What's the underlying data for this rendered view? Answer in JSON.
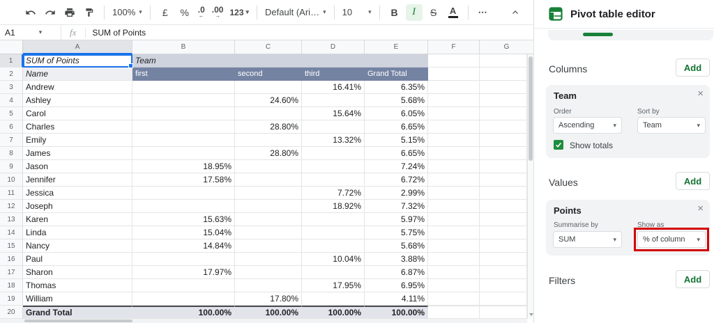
{
  "toolbar": {
    "zoom_value": "100%",
    "currency_label": "£",
    "percent_label": "%",
    "decrease_decimal_label": ".0",
    "decrease_decimal_arrow": "←",
    "increase_decimal_label": ".00",
    "increase_decimal_arrow": "→",
    "more_formats_label": "123",
    "font_value": "Default (Ari…",
    "font_size_value": "10",
    "bold_label": "B",
    "italic_label": "I",
    "strikethrough_label": "S",
    "text_color_label": "A",
    "more_label": "⋯"
  },
  "formula_bar": {
    "cell_ref": "A1",
    "value": "SUM of Points"
  },
  "sheet": {
    "column_letters": [
      "A",
      "B",
      "C",
      "D",
      "E",
      "F",
      "G"
    ],
    "pivot": {
      "title_row": {
        "num": "1",
        "a": "SUM of Points",
        "b": "Team"
      },
      "header_row": {
        "num": "2",
        "a": "Name",
        "first": "first",
        "second": "second",
        "third": "third",
        "grand_total": "Grand Total"
      },
      "rows": [
        {
          "num": "3",
          "name": "Andrew",
          "first": "",
          "second": "",
          "third": "16.41%",
          "grand_total": "6.35%"
        },
        {
          "num": "4",
          "name": "Ashley",
          "first": "",
          "second": "24.60%",
          "third": "",
          "grand_total": "5.68%"
        },
        {
          "num": "5",
          "name": "Carol",
          "first": "",
          "second": "",
          "third": "15.64%",
          "grand_total": "6.05%"
        },
        {
          "num": "6",
          "name": "Charles",
          "first": "",
          "second": "28.80%",
          "third": "",
          "grand_total": "6.65%"
        },
        {
          "num": "7",
          "name": "Emily",
          "first": "",
          "second": "",
          "third": "13.32%",
          "grand_total": "5.15%"
        },
        {
          "num": "8",
          "name": "James",
          "first": "",
          "second": "28.80%",
          "third": "",
          "grand_total": "6.65%"
        },
        {
          "num": "9",
          "name": "Jason",
          "first": "18.95%",
          "second": "",
          "third": "",
          "grand_total": "7.24%"
        },
        {
          "num": "10",
          "name": "Jennifer",
          "first": "17.58%",
          "second": "",
          "third": "",
          "grand_total": "6.72%"
        },
        {
          "num": "11",
          "name": "Jessica",
          "first": "",
          "second": "",
          "third": "7.72%",
          "grand_total": "2.99%"
        },
        {
          "num": "12",
          "name": "Joseph",
          "first": "",
          "second": "",
          "third": "18.92%",
          "grand_total": "7.32%"
        },
        {
          "num": "13",
          "name": "Karen",
          "first": "15.63%",
          "second": "",
          "third": "",
          "grand_total": "5.97%"
        },
        {
          "num": "14",
          "name": "Linda",
          "first": "15.04%",
          "second": "",
          "third": "",
          "grand_total": "5.75%"
        },
        {
          "num": "15",
          "name": "Nancy",
          "first": "14.84%",
          "second": "",
          "third": "",
          "grand_total": "5.68%"
        },
        {
          "num": "16",
          "name": "Paul",
          "first": "",
          "second": "",
          "third": "10.04%",
          "grand_total": "3.88%"
        },
        {
          "num": "17",
          "name": "Sharon",
          "first": "17.97%",
          "second": "",
          "third": "",
          "grand_total": "6.87%"
        },
        {
          "num": "18",
          "name": "Thomas",
          "first": "",
          "second": "",
          "third": "17.95%",
          "grand_total": "6.95%"
        },
        {
          "num": "19",
          "name": "William",
          "first": "",
          "second": "17.80%",
          "third": "",
          "grand_total": "4.11%"
        }
      ],
      "grand_total_row": {
        "num": "20",
        "name": "Grand Total",
        "first": "100.00%",
        "second": "100.00%",
        "third": "100.00%",
        "grand_total": "100.00%"
      }
    }
  },
  "panel": {
    "title": "Pivot table editor",
    "columns_section": {
      "label": "Columns",
      "add_label": "Add",
      "card": {
        "title": "Team",
        "close": "×",
        "order_label": "Order",
        "order_value": "Ascending",
        "sort_by_label": "Sort by",
        "sort_by_value": "Team",
        "show_totals_label": "Show totals"
      }
    },
    "values_section": {
      "label": "Values",
      "add_label": "Add",
      "card": {
        "title": "Points",
        "close": "×",
        "summarise_by_label": "Summarise by",
        "summarise_by_value": "SUM",
        "show_as_label": "Show as",
        "show_as_value": "% of column"
      }
    },
    "filters_section": {
      "label": "Filters",
      "add_label": "Add"
    }
  },
  "colors": {
    "accent_blue": "#1a73e8",
    "green": "#188038",
    "pivot_header_dark": "#7583a3",
    "pivot_header_light": "#ced3de",
    "grand_total_bg": "#e1e4eb",
    "annotation_red": "#d40000"
  }
}
